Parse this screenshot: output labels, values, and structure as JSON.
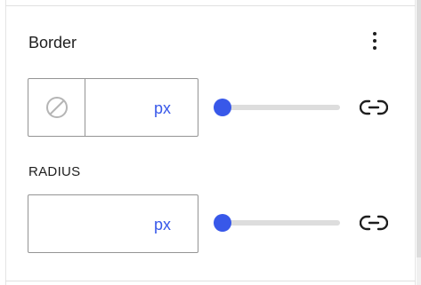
{
  "panel": {
    "title": "Border",
    "more_icon": "vertical-ellipsis-icon"
  },
  "border": {
    "style_icon": "no-style-circle-slash-icon",
    "width_value": "",
    "unit": "px",
    "slider_fraction": 0.0,
    "link_icon": "link-sides-icon"
  },
  "radius": {
    "label": "RADIUS",
    "value": "",
    "unit": "px",
    "slider_fraction": 0.0,
    "link_icon": "link-corners-icon"
  },
  "colors": {
    "accent": "#3858e9",
    "text": "#1e1e1e",
    "input_border": "#949494",
    "track": "#dddddd"
  }
}
